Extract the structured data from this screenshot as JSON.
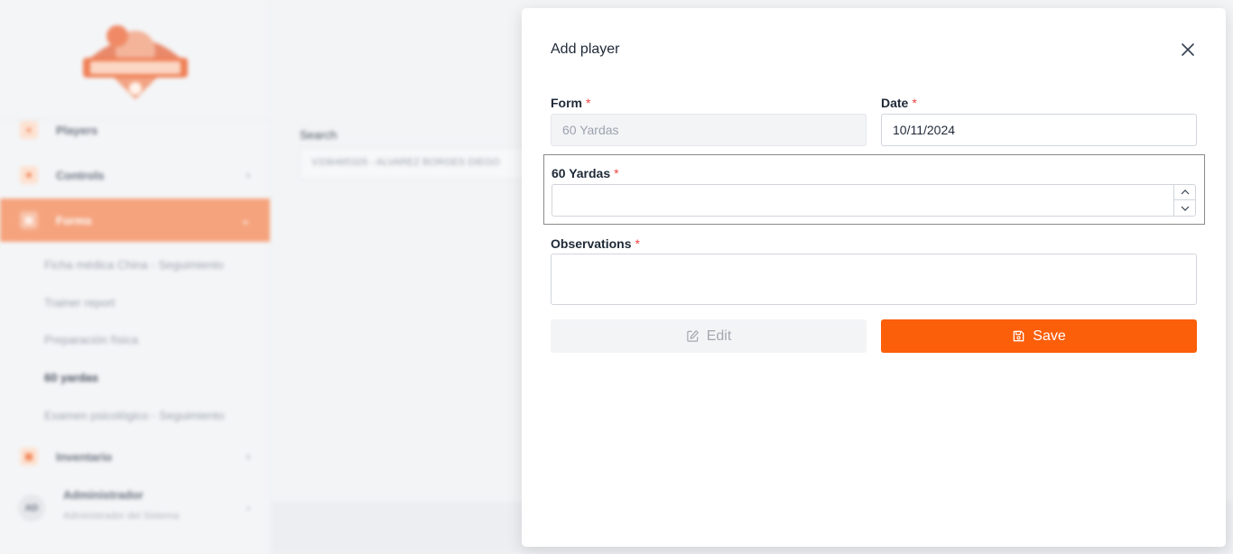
{
  "sidebar": {
    "items": [
      {
        "label": "Players"
      },
      {
        "label": "Controls"
      },
      {
        "label": "Forms"
      },
      {
        "label": "Inventario"
      }
    ],
    "forms_submenu": [
      {
        "label": "Ficha médica China - Seguimiento"
      },
      {
        "label": "Trainer report"
      },
      {
        "label": "Preparación física"
      },
      {
        "label": "60 yardas"
      },
      {
        "label": "Examen psicológico - Seguimiento"
      }
    ],
    "user": {
      "initials": "AD",
      "name": "Administrador",
      "role": "Administrador del Sistema"
    }
  },
  "main": {
    "search_label": "Search",
    "search_value": "V336465326 - ALVAREZ BORGES DIEGO"
  },
  "drawer": {
    "title": "Add player",
    "form_label": "Form",
    "form_value": "60 Yardas",
    "date_label": "Date",
    "date_value": "10/11/2024",
    "metric_label": "60 Yardas",
    "metric_value": "",
    "observations_label": "Observations",
    "observations_value": "",
    "required_mark": "*",
    "edit_label": "Edit",
    "save_label": "Save"
  },
  "colors": {
    "accent": "#fc5f0a",
    "sidebar_active": "#f5a37d",
    "required": "#ef4444"
  },
  "icons": {
    "close": "close-icon",
    "edit": "pencil-square-icon",
    "save": "floppy-disk-icon",
    "spin_up": "chevron-up-icon",
    "spin_down": "chevron-down-icon"
  }
}
